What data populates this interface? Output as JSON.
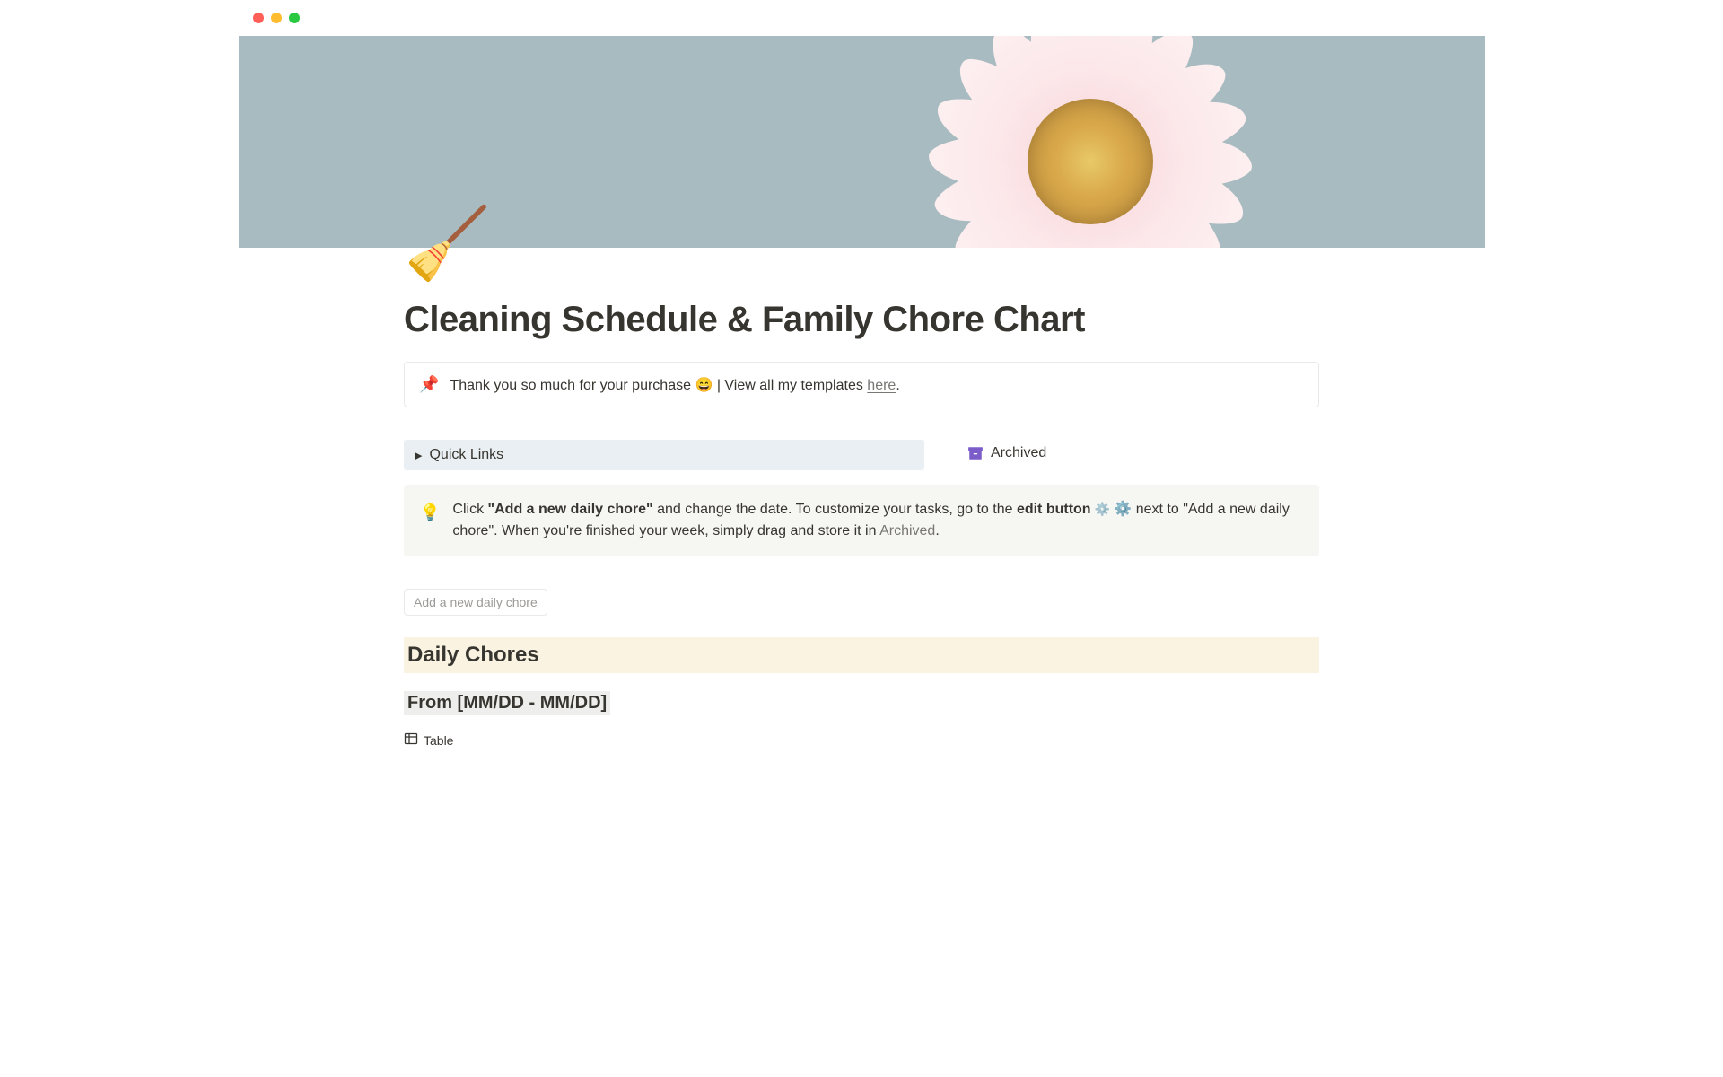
{
  "page": {
    "icon": "🧹",
    "title": "Cleaning Schedule & Family Chore Chart"
  },
  "thanks_callout": {
    "icon": "📌",
    "text_before": "Thank you so much for your purchase 😄 | View all my templates ",
    "link_text": "here",
    "text_after": "."
  },
  "quick_links": {
    "label": "Quick Links"
  },
  "archived": {
    "label": "Archived"
  },
  "tip": {
    "icon": "💡",
    "part1": "Click ",
    "bold1": "\"Add a new daily chore\"",
    "part2": " and change the date. To customize your tasks, go to the ",
    "bold2": "edit button",
    "part3": " ⚙️ next to \"Add a new daily chore\". When you're finished your week, simply drag and store it in ",
    "link": "Archived",
    "part4": "."
  },
  "add_button": {
    "label": "Add a new daily chore"
  },
  "section": {
    "heading": "Daily Chores",
    "subheading": "From [MM/DD - MM/DD]"
  },
  "view": {
    "label": "Table"
  }
}
